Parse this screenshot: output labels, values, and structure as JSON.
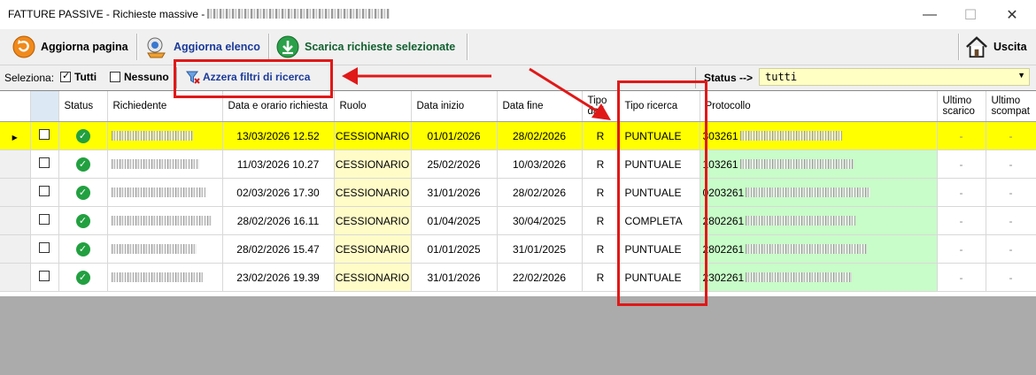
{
  "window": {
    "title": "FATTURE PASSIVE - Richieste massive -",
    "minimize": "—",
    "maximize": "☐",
    "close": "✕"
  },
  "toolbar": {
    "refresh_page": "Aggiorna pagina",
    "refresh_list": "Aggiorna elenco",
    "download_selected": "Scarica richieste selezionate",
    "exit": "Uscita"
  },
  "filters": {
    "select_label": "Seleziona:",
    "all_label": "Tutti",
    "all_checked": true,
    "none_label": "Nessuno",
    "none_checked": false,
    "reset_label": "Azzera filtri di ricerca",
    "status_label": "Status -->",
    "status_value": "tutti"
  },
  "grid": {
    "headers": {
      "status": "Status",
      "richiedente": "Richiedente",
      "data_richiesta": "Data e orario richiesta",
      "ruolo": "Ruolo",
      "data_inizio": "Data inizio",
      "data_fine": "Data fine",
      "tipo_dati": "Tipo dati",
      "tipo_ricerca": "Tipo ricerca",
      "protocollo": "Protocollo",
      "ultimo_scarico": "Ultimo scarico",
      "ultimo_scompat": "Ultimo scompat"
    },
    "rows": [
      {
        "data_richiesta": "13/03/2026 12.52",
        "ruolo": "CESSIONARIO",
        "data_inizio": "01/01/2026",
        "data_fine": "28/02/2026",
        "tipo_dati": "R",
        "tipo_ricerca": "PUNTUALE",
        "protocollo": "303261",
        "ultimo_scarico": "-",
        "ultimo_scompat": "-"
      },
      {
        "data_richiesta": "11/03/2026 10.27",
        "ruolo": "CESSIONARIO",
        "data_inizio": "25/02/2026",
        "data_fine": "10/03/2026",
        "tipo_dati": "R",
        "tipo_ricerca": "PUNTUALE",
        "protocollo": "103261",
        "ultimo_scarico": "-",
        "ultimo_scompat": "-"
      },
      {
        "data_richiesta": "02/03/2026 17.30",
        "ruolo": "CESSIONARIO",
        "data_inizio": "31/01/2026",
        "data_fine": "28/02/2026",
        "tipo_dati": "R",
        "tipo_ricerca": "PUNTUALE",
        "protocollo": "0203261",
        "ultimo_scarico": "-",
        "ultimo_scompat": "-"
      },
      {
        "data_richiesta": "28/02/2026 16.11",
        "ruolo": "CESSIONARIO",
        "data_inizio": "01/04/2025",
        "data_fine": "30/04/2025",
        "tipo_dati": "R",
        "tipo_ricerca": "COMPLETA",
        "protocollo": "2802261",
        "ultimo_scarico": "-",
        "ultimo_scompat": "-"
      },
      {
        "data_richiesta": "28/02/2026 15.47",
        "ruolo": "CESSIONARIO",
        "data_inizio": "01/01/2025",
        "data_fine": "31/01/2025",
        "tipo_dati": "R",
        "tipo_ricerca": "PUNTUALE",
        "protocollo": "2802261",
        "ultimo_scarico": "-",
        "ultimo_scompat": "-"
      },
      {
        "data_richiesta": "23/02/2026 19.39",
        "ruolo": "CESSIONARIO",
        "data_inizio": "31/01/2026",
        "data_fine": "22/02/2026",
        "tipo_dati": "R",
        "tipo_ricerca": "PUNTUALE",
        "protocollo": "2302261",
        "ultimo_scarico": "-",
        "ultimo_scompat": "-"
      }
    ]
  },
  "colors": {
    "selected_row": "#ffff00",
    "ruolo_cell": "#fffcc8",
    "protocollo_cell": "#c8fcc8",
    "status_ok": "#22a040",
    "annotation": "#e01818"
  }
}
